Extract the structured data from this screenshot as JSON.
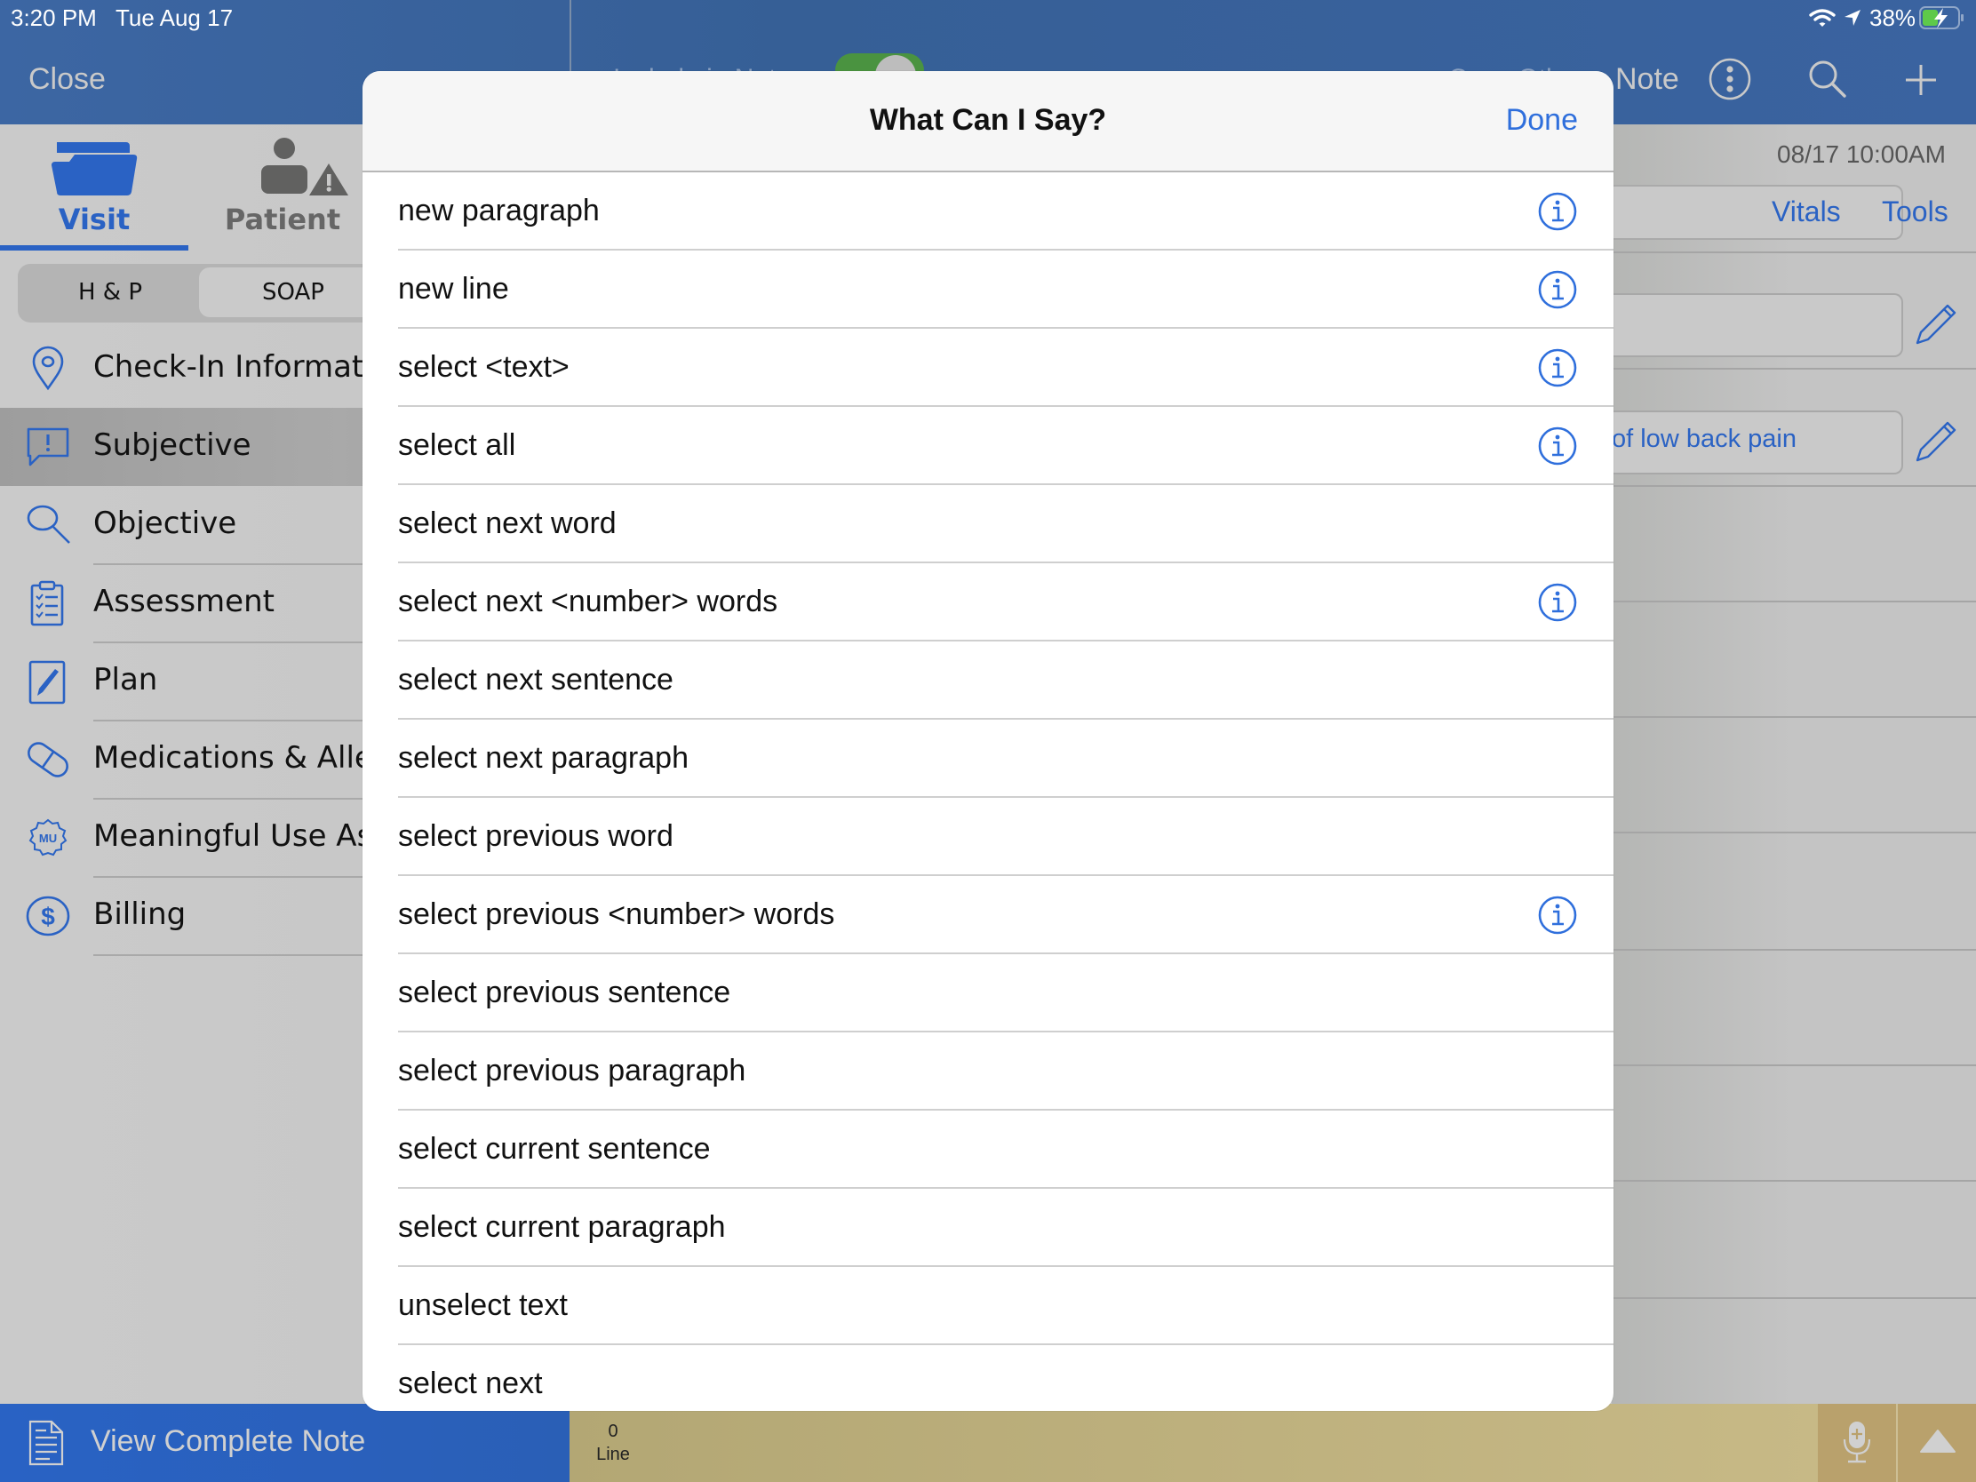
{
  "status_bar": {
    "time": "3:20 PM",
    "date": "Tue Aug 17",
    "battery_percent": "38%",
    "icons": [
      "wifi-icon",
      "location-arrow-icon",
      "battery-charging-icon"
    ]
  },
  "header": {
    "close_label": "Close",
    "note_label": "Note",
    "obscured_left_text": "Include in Note",
    "obscured_right_text": "Copy Other",
    "toggle_on": true,
    "icons": [
      "more-vertical-icon",
      "search-icon",
      "plus-icon"
    ]
  },
  "sidebar": {
    "tabs": [
      {
        "label": "Visit",
        "icon": "folder-icon",
        "active": true
      },
      {
        "label": "Patient",
        "icon": "patient-alert-icon",
        "active": false
      }
    ],
    "segments": [
      {
        "label": "H & P",
        "active": false
      },
      {
        "label": "SOAP",
        "active": true
      }
    ],
    "items": [
      {
        "label": "Check-In Information",
        "icon": "location-pin-icon",
        "selected": false
      },
      {
        "label": "Subjective",
        "icon": "speech-bubble-alert-icon",
        "selected": true
      },
      {
        "label": "Objective",
        "icon": "magnifier-icon",
        "selected": false
      },
      {
        "label": "Assessment",
        "icon": "clipboard-checklist-icon",
        "selected": false
      },
      {
        "label": "Plan",
        "icon": "pen-icon",
        "selected": false
      },
      {
        "label": "Medications & Allergies",
        "icon": "pill-icon",
        "selected": false
      },
      {
        "label": "Meaningful Use Assistant",
        "icon": "mu-badge-icon",
        "selected": false
      },
      {
        "label": "Billing",
        "icon": "dollar-circle-icon",
        "selected": false
      }
    ]
  },
  "right_panel": {
    "datetime": "08/17 10:00AM",
    "vitals_label": "Vitals",
    "tools_label": "Tools",
    "field_2_text": "of low back pain"
  },
  "bottom_bar": {
    "view_complete_note_label": "View Complete Note",
    "line_count": "0",
    "line_label": "Line",
    "icons": [
      "document-icon",
      "microphone-plus-icon",
      "triangle-up-icon"
    ]
  },
  "modal": {
    "title": "What Can I Say?",
    "done_label": "Done",
    "commands": [
      {
        "text": "new paragraph",
        "has_info": true
      },
      {
        "text": "new line",
        "has_info": true
      },
      {
        "text": "select <text>",
        "has_info": true
      },
      {
        "text": "select all",
        "has_info": true
      },
      {
        "text": "select next word",
        "has_info": false
      },
      {
        "text": "select next <number> words",
        "has_info": true
      },
      {
        "text": "select next sentence",
        "has_info": false
      },
      {
        "text": "select next paragraph",
        "has_info": false
      },
      {
        "text": "select previous word",
        "has_info": false
      },
      {
        "text": "select previous <number> words",
        "has_info": true
      },
      {
        "text": "select previous sentence",
        "has_info": false
      },
      {
        "text": "select previous paragraph",
        "has_info": false
      },
      {
        "text": "select current sentence",
        "has_info": false
      },
      {
        "text": "select current paragraph",
        "has_info": false
      },
      {
        "text": "unselect text",
        "has_info": false
      },
      {
        "text": "select next",
        "has_info": false
      }
    ]
  },
  "colors": {
    "header_blue": "#3a63a0",
    "accent_blue": "#2a62c4",
    "link_blue": "#2f6fdc",
    "toggle_green": "#4a9340",
    "bottom_gold": "#b9a16c",
    "battery_green": "#5ec94a"
  }
}
